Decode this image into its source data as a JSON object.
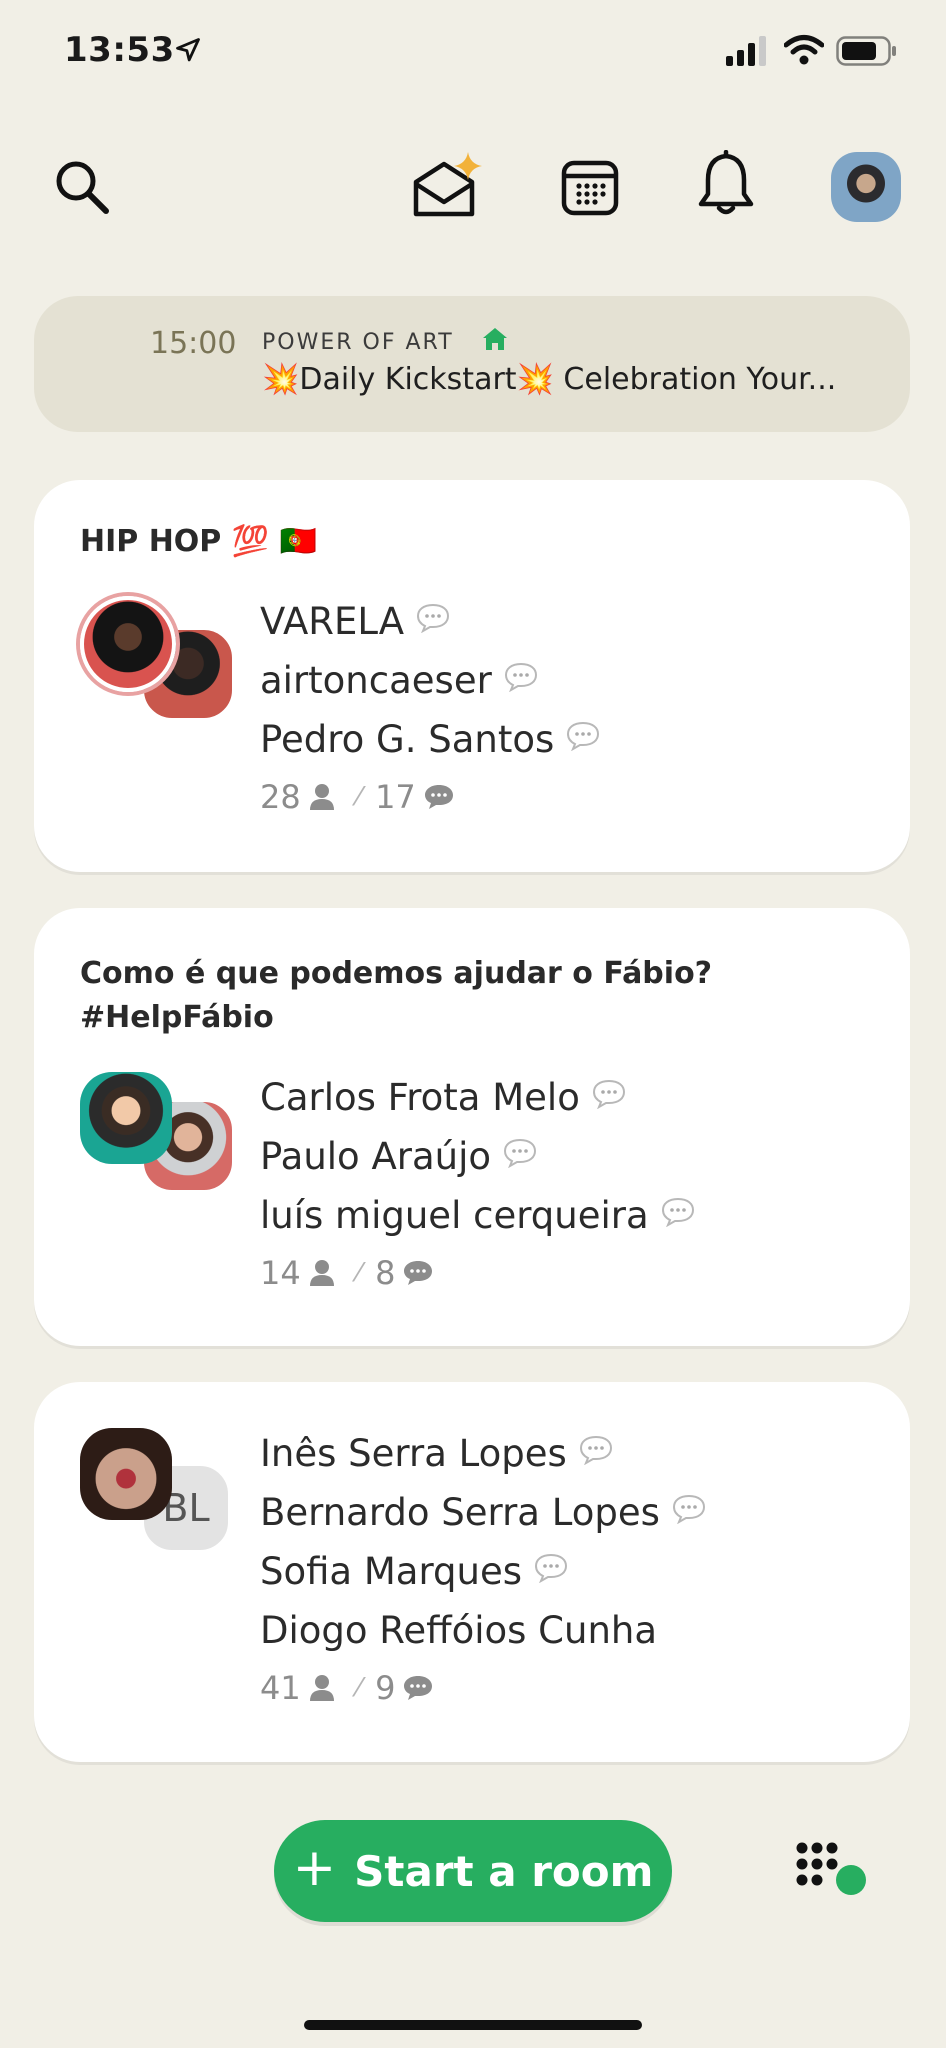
{
  "status_bar": {
    "time": "13:53"
  },
  "upcoming": {
    "time": "15:00",
    "club": "POWER OF ART",
    "title": "💥Daily Kickstart💥 Celebration Your..."
  },
  "rooms": [
    {
      "title": "HIP HOP 💯 🇵🇹",
      "speakers": [
        "VARELA",
        "airtoncaeser",
        "Pedro G. Santos"
      ],
      "listeners": "28",
      "speakers_count": "17"
    },
    {
      "title": "Como é que podemos ajudar o Fábio? #HelpFábio",
      "speakers": [
        "Carlos Frota Melo",
        "Paulo Araújo",
        "luís miguel cerqueira"
      ],
      "listeners": "14",
      "speakers_count": "8"
    },
    {
      "title": "",
      "speakers": [
        "Inês Serra Lopes",
        "Bernardo Serra Lopes",
        "Sofia Marques",
        "Diogo Reffóios Cunha"
      ],
      "listeners": "41",
      "speakers_count": "9",
      "avatar_initials": "BL"
    }
  ],
  "actions": {
    "start_room": "Start a room"
  },
  "colors": {
    "accent_green": "#27ae60",
    "background": "#f1efe6",
    "card": "#ffffff"
  }
}
